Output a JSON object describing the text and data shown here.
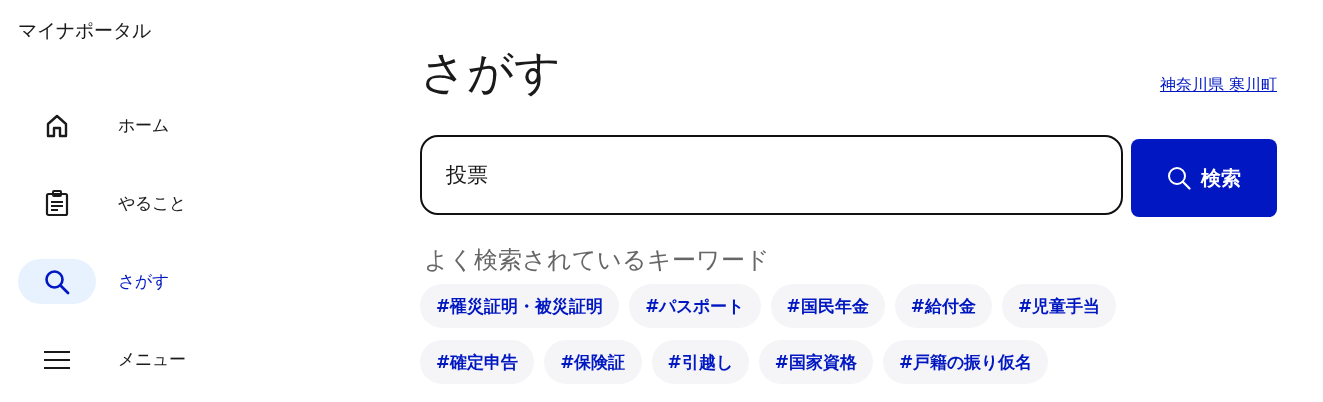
{
  "app_title": "マイナポータル",
  "nav": [
    {
      "kind": "home",
      "label": "ホーム",
      "selected": false
    },
    {
      "kind": "todo",
      "label": "やること",
      "selected": false
    },
    {
      "kind": "search",
      "label": "さがす",
      "selected": true
    },
    {
      "kind": "menu",
      "label": "メニュー",
      "selected": false
    }
  ],
  "page_title": "さがす",
  "location_link": "神奈川県 寒川町",
  "search": {
    "value": "投票",
    "button": "検索"
  },
  "keywords_heading": "よく検索されているキーワード",
  "keywords": [
    "#罹災証明・被災証明",
    "#パスポート",
    "#国民年金",
    "#給付金",
    "#児童手当",
    "#確定申告",
    "#保険証",
    "#引越し",
    "#国家資格",
    "#戸籍の振り仮名"
  ]
}
